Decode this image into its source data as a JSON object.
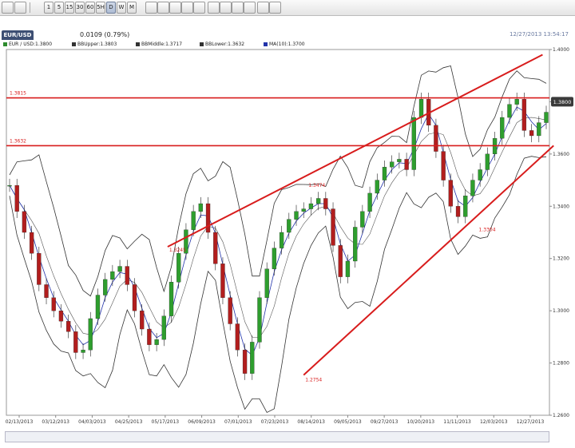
{
  "toolbar": {
    "periods": [
      "1",
      "5",
      "15",
      "30",
      "60",
      "5H",
      "D",
      "W",
      "M"
    ],
    "active_period": "D",
    "icons": [
      "crosshair-icon",
      "cursor-icon",
      "zoom-in-icon",
      "zoom-out-icon",
      "zoom-fit-icon",
      "zoom-reset-icon",
      "zoom-area-icon",
      "line-tool-icon",
      "text-tool-icon",
      "export-icon",
      "print-icon",
      "grid-icon",
      "delete-icon"
    ]
  },
  "info": {
    "pair": "EUR/USD",
    "change": "0.0109 (0.79%)",
    "timestamp": "12/27/2013 13:54:17"
  },
  "legend": {
    "items": [
      {
        "label": "EUR / USD:1.3800",
        "color": "#2e8b2e"
      },
      {
        "label": "BBUpper:1.3803",
        "color": "#333333"
      },
      {
        "label": "BBMiddle:1.3717",
        "color": "#333333"
      },
      {
        "label": "BBLower:1.3632",
        "color": "#333333"
      },
      {
        "label": "MA(10):1.3700",
        "color": "#2233aa"
      }
    ]
  },
  "chart_data": {
    "type": "line",
    "title": "",
    "xlabel": "",
    "ylabel": "",
    "x_ticks": [
      "02/13/2013",
      "03/12/2013",
      "04/03/2013",
      "04/25/2013",
      "05/17/2013",
      "06/09/2013",
      "07/01/2013",
      "07/23/2013",
      "08/14/2013",
      "09/05/2013",
      "09/27/2013",
      "10/20/2013",
      "11/11/2013",
      "12/03/2013",
      "12/27/2013"
    ],
    "y_ticks": [
      "1.4000",
      "1.3800",
      "1.3600",
      "1.3400",
      "1.3200",
      "1.3000",
      "1.2800",
      "1.2600"
    ],
    "ylim": [
      1.26,
      1.4
    ],
    "current_price": "1.3800",
    "series": [
      {
        "values": [
          1.348,
          1.338,
          1.33,
          1.322,
          1.31,
          1.305,
          1.3,
          1.296,
          1.292,
          1.284,
          1.285,
          1.297,
          1.306,
          1.312,
          1.315,
          1.317,
          1.31,
          1.3,
          1.293,
          1.287,
          1.289,
          1.298,
          1.311,
          1.322,
          1.331,
          1.338,
          1.341,
          1.33,
          1.318,
          1.305,
          1.295,
          1.285,
          1.276,
          1.288,
          1.305,
          1.316,
          1.324,
          1.33,
          1.335,
          1.338,
          1.339,
          1.341,
          1.343,
          1.339,
          1.325,
          1.313,
          1.319,
          1.332,
          1.338,
          1.345,
          1.35,
          1.355,
          1.357,
          1.358,
          1.354,
          1.374,
          1.381,
          1.371,
          1.361,
          1.35,
          1.34,
          1.336,
          1.344,
          1.35,
          1.354,
          1.36,
          1.366,
          1.374,
          1.379,
          1.381,
          1.369,
          1.367,
          1.372,
          1.376
        ]
      }
    ],
    "annotations": [
      "1.3815",
      "1.3632",
      "1.3474",
      "1.3245",
      "1.2754",
      "1.3304"
    ]
  }
}
